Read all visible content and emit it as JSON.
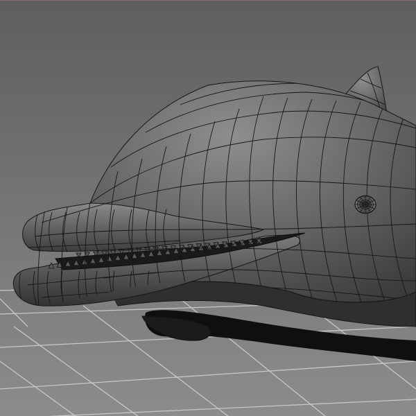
{
  "viewport": {
    "background_top": "#5e5e5e",
    "background_bottom": "#8c8c8c",
    "grid_color": "#c8c8c8",
    "wire_color": "#161616",
    "shade_light": "#9a9a9a",
    "shade_dark": "#2c2c2c",
    "frame_color": "#8a6a6a"
  },
  "model": {
    "icon": "dolphin-wireframe-mesh",
    "display_mode": "smooth-shade-with-wireframe"
  }
}
